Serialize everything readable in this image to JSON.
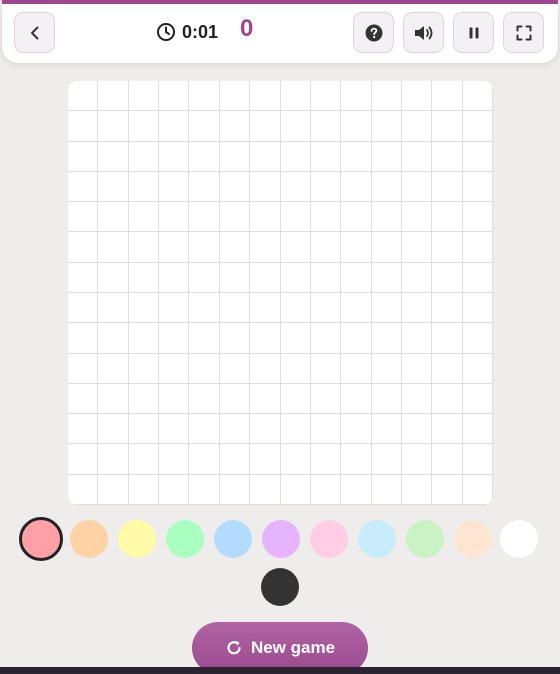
{
  "header": {
    "timer": "0:01",
    "score": "0",
    "icons": [
      "back-chevron-icon",
      "clock-icon",
      "help-icon",
      "sound-icon",
      "pause-icon",
      "fullscreen-icon"
    ]
  },
  "board": {
    "rows": 14,
    "cols": 14
  },
  "palette": {
    "selected_index": 0,
    "colors": [
      "#ff9fa6",
      "#ffd2a5",
      "#fffba6",
      "#a9ffbf",
      "#b3dbfd",
      "#e6b3fd",
      "#ffcee4",
      "#c8ecfc",
      "#cbf2c4",
      "#fde6d1",
      "#ffffff",
      "#333333"
    ]
  },
  "actions": {
    "new_game_label": "New game"
  },
  "theme": {
    "accent": "#a0468e",
    "background": "#efedeb"
  }
}
